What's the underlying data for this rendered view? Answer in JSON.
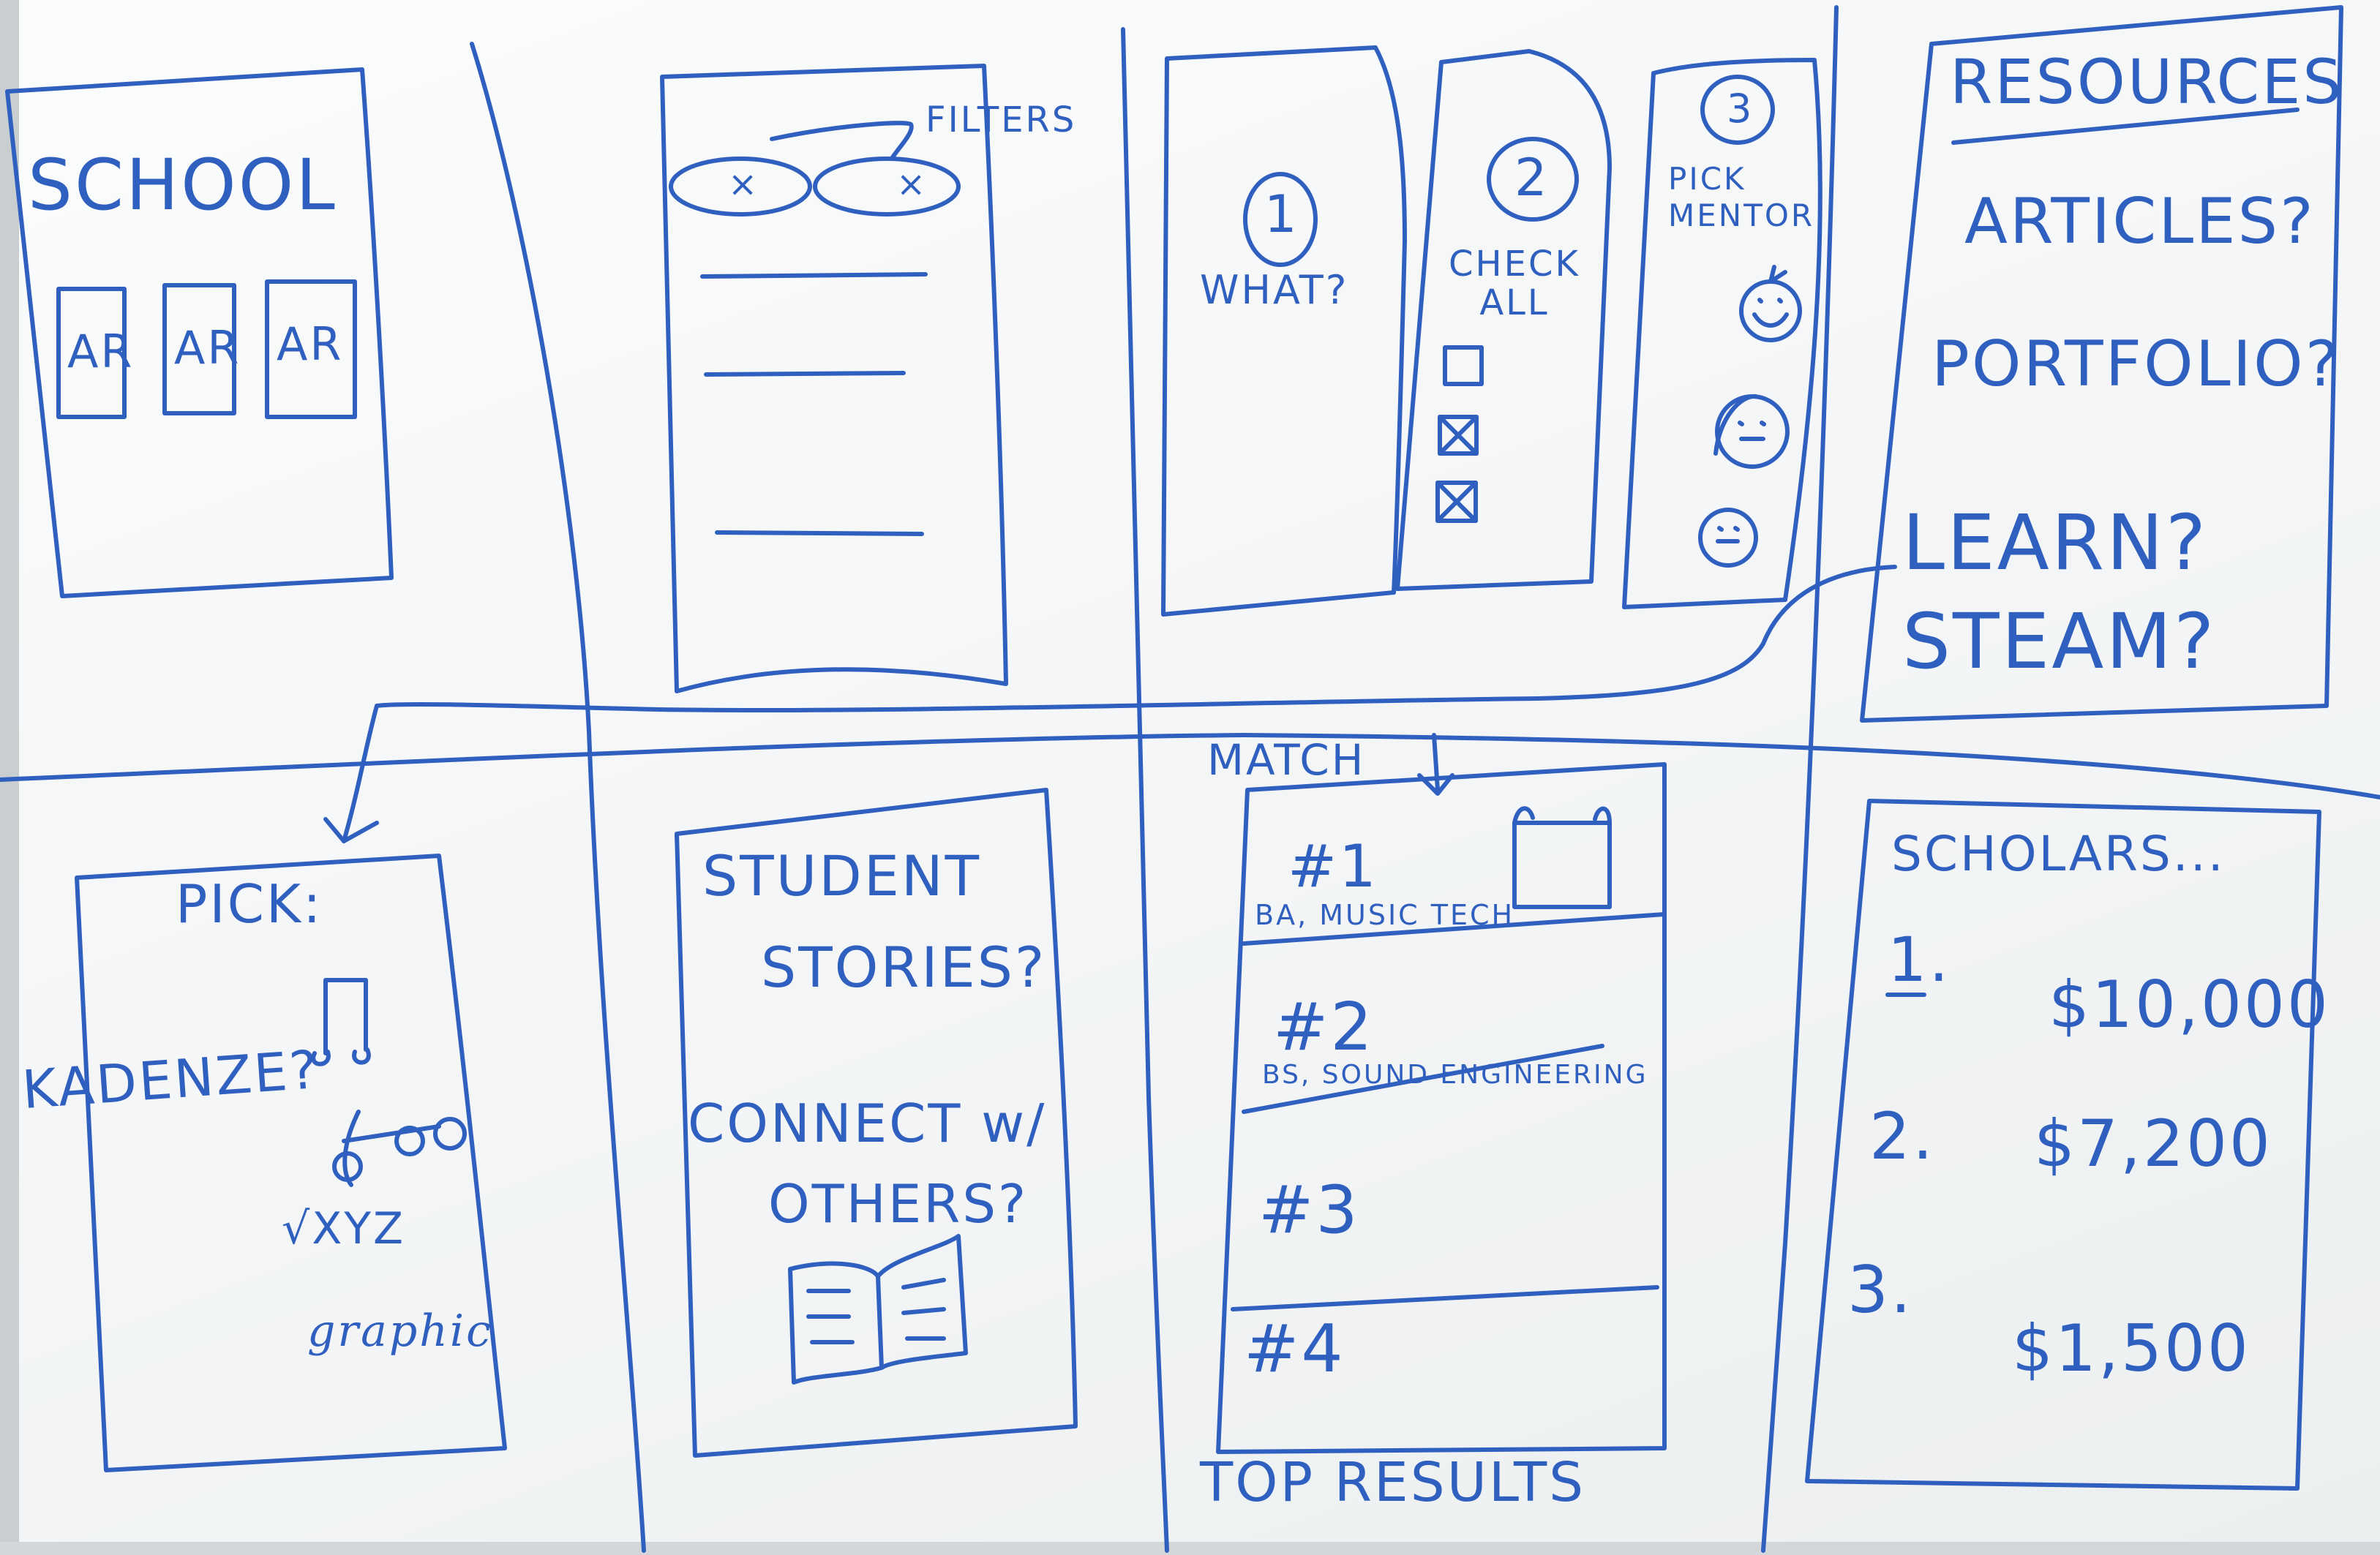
{
  "board": {
    "school_panel": {
      "title": "SCHOOL",
      "cards": [
        "AR",
        "AR",
        "AR"
      ]
    },
    "filters_panel": {
      "label": "FILTERS",
      "chip_mark": "×"
    },
    "steps_panel": {
      "step1_number": "1",
      "step1_text": "WHAT?",
      "step2_number": "2",
      "step2_text": "CHECK ALL",
      "step3_number": "3",
      "step3_text": "PICK MENTOR"
    },
    "resources_panel": {
      "title": "RESOURCES",
      "items": [
        "ARTICLES?",
        "PORTFOLIO?",
        "LEARN?",
        "STEAM?"
      ]
    },
    "pick_panel": {
      "title": "PICK:",
      "side_note": "KADENZE?",
      "item_math": "√XYZ",
      "item_graphic": "graphic"
    },
    "stories_panel": {
      "line1": "STUDENT",
      "line2": "STORIES?",
      "line3": "CONNECT w/",
      "line4": "OTHERS?"
    },
    "match_panel": {
      "header": "MATCH",
      "rows": [
        {
          "rank": "#1",
          "detail": "BA, MUSIC TECH"
        },
        {
          "rank": "#2",
          "detail": "BS, SOUND ENGINEERING"
        },
        {
          "rank": "#3",
          "detail": ""
        },
        {
          "rank": "#4",
          "detail": ""
        }
      ],
      "footer": "TOP RESULTS"
    },
    "scholarships_panel": {
      "title": "SCHOLARS...",
      "items": [
        {
          "num": "1.",
          "amount": "$10,000"
        },
        {
          "num": "2.",
          "amount": "$7,200"
        },
        {
          "num": "3.",
          "amount": "$1,500"
        }
      ]
    }
  }
}
